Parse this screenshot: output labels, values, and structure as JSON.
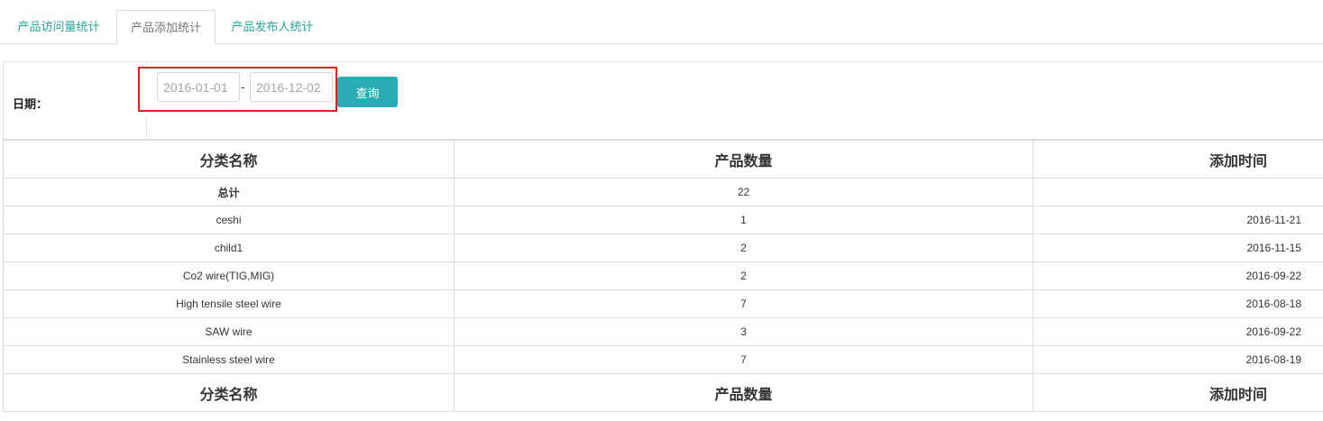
{
  "tabs": [
    {
      "label": "产品访问量统计",
      "active": false
    },
    {
      "label": "产品添加统计",
      "active": true
    },
    {
      "label": "产品发布人统计",
      "active": false
    }
  ],
  "filter": {
    "label": "日期：",
    "start_date": "2016-01-01",
    "end_date": "2016-12-02",
    "separator": "-",
    "query_label": "查询"
  },
  "table": {
    "headers": [
      "分类名称",
      "产品数量",
      "添加时间"
    ],
    "total": {
      "name": "总计",
      "count": "22",
      "date": ""
    },
    "rows": [
      {
        "name": "ceshi",
        "count": "1",
        "date": "2016-11-21"
      },
      {
        "name": "child1",
        "count": "2",
        "date": "2016-11-15"
      },
      {
        "name": "Co2 wire(TIG,MIG)",
        "count": "2",
        "date": "2016-09-22"
      },
      {
        "name": "High tensile steel wire",
        "count": "7",
        "date": "2016-08-18"
      },
      {
        "name": "SAW wire",
        "count": "3",
        "date": "2016-09-22"
      },
      {
        "name": "Stainless steel wire",
        "count": "7",
        "date": "2016-08-19"
      }
    ],
    "footer_headers": [
      "分类名称",
      "产品数量",
      "添加时间"
    ]
  },
  "colors": {
    "accent": "#2aacb5",
    "tab_text": "#26a69a",
    "highlight": "#e02020"
  }
}
